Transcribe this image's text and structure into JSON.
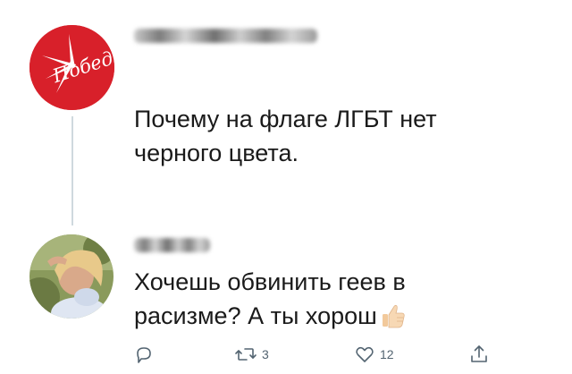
{
  "tweet1": {
    "author": "Победа",
    "logo_text": "Победа",
    "lines": [
      "Почему на флаге ЛГБТ нет",
      "черного цвета."
    ]
  },
  "tweet2": {
    "lines": [
      "Хочешь обвинить геев в",
      "расизме? А ты хорош"
    ],
    "emoji": "thumbs-up-icon"
  },
  "actions": {
    "reply": {
      "icon": "reply-icon",
      "count": ""
    },
    "retweet": {
      "icon": "retweet-icon",
      "count": "3"
    },
    "like": {
      "icon": "heart-icon",
      "count": "12"
    },
    "share": {
      "icon": "share-icon",
      "count": ""
    }
  },
  "colors": {
    "logo_red": "#d8202a",
    "text": "#1a1a1a",
    "icon_gray": "#536471",
    "thread_line": "#cfd9de"
  }
}
